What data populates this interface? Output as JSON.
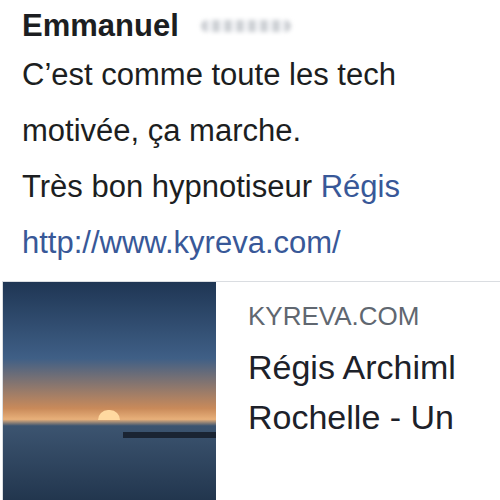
{
  "comment": {
    "author": "Emmanuel",
    "lines": [
      [
        {
          "kind": "text",
          "text": "C’est comme toute les tech"
        }
      ],
      [
        {
          "kind": "text",
          "text": "motivée, ça marche."
        }
      ],
      [
        {
          "kind": "text",
          "text": "Très bon hypnotiseur "
        },
        {
          "kind": "link",
          "text": "Régis"
        }
      ],
      [
        {
          "kind": "link",
          "text": "http://www.kyreva.com/"
        }
      ]
    ]
  },
  "link_preview": {
    "domain": "KYREVA.COM",
    "title_lines": [
      "Régis Archiml",
      "Rochelle - Un"
    ]
  }
}
